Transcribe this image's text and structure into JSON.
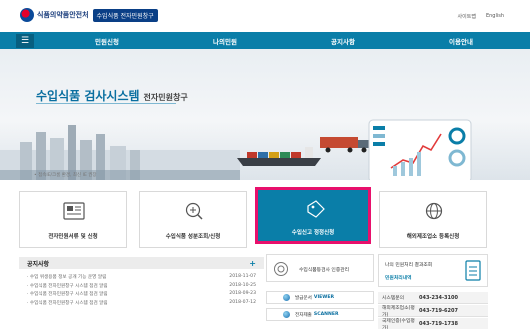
{
  "header": {
    "org_name": "식품의약품안전처",
    "service_badge": "수입식품 전자민원창구",
    "links": [
      "사이트맵",
      "English"
    ]
  },
  "nav": {
    "toggle_icon": "hamburger-menu-icon",
    "items": [
      "민원신청",
      "나의민원",
      "공지사항",
      "이용안내"
    ]
  },
  "hero": {
    "title_main": "수입식품 검사시스템",
    "title_sub": "전자민원창구",
    "note": "• 접속IE/크롬 환경, 최신 IE 권장"
  },
  "quick_menu": [
    {
      "label": "전자민원서류 및 신청",
      "icon": "document-icon"
    },
    {
      "label": "수입식품 성분조회/신청",
      "icon": "magnifier-plus-icon"
    },
    {
      "label": "수입신고 정정신청",
      "icon": "tag-icon",
      "active": true
    },
    {
      "label": "해외제조업소 등록신청",
      "icon": "globe-icon"
    }
  ],
  "notice": {
    "title": "공지사항",
    "more": "+",
    "items": [
      {
        "text": "· 수입 위생용품 정보 공개 기능 운영 알림",
        "date": "2018-11-07"
      },
      {
        "text": "· 수입식품 전자민원창구 시스템 점검 알림",
        "date": "2018-10-25"
      },
      {
        "text": "· 수입식품 전자민원창구 시스템 점검 알림",
        "date": "2018-09-23"
      },
      {
        "text": "· 수입식품 전자민원창구 시스템 점검 알림",
        "date": "2018-07-12"
      }
    ]
  },
  "widgets": {
    "cert_label": "수입식품등검사 인증관리",
    "viewer_prefix": "발급문서",
    "viewer_name": "VIEWER",
    "scanner_prefix": "전자제출",
    "scanner_name": "SCANNER",
    "result_line1": "나의 민원처리 결과조회",
    "result_line2": "민원처리내역"
  },
  "contacts": [
    {
      "label": "시스템문의",
      "number": "043-234-3100"
    },
    {
      "label": "해외제조업소(평가)",
      "number": "043-719-6207"
    },
    {
      "label": "국제인증(수입평가)",
      "number": "043-719-1738"
    }
  ]
}
